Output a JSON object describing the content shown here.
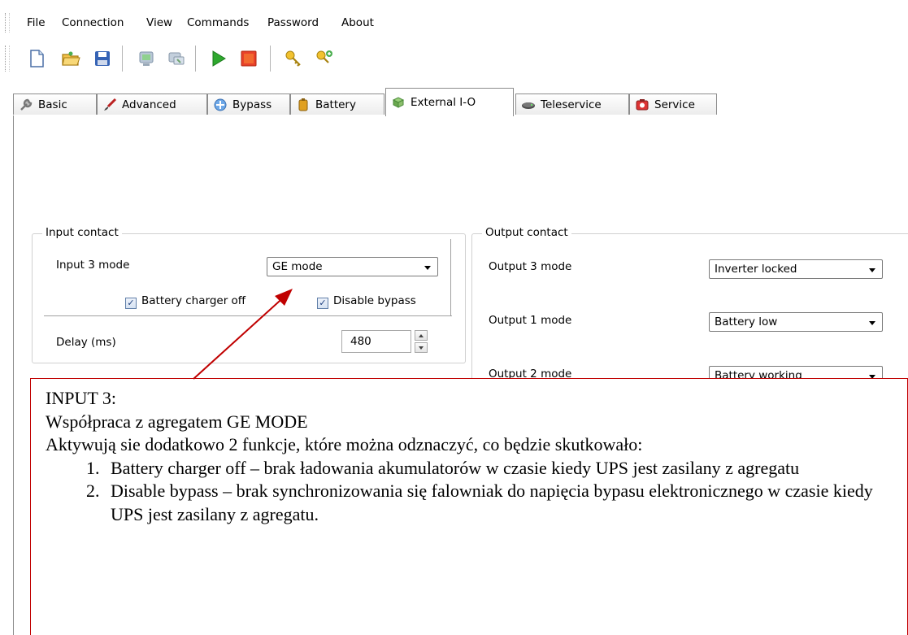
{
  "menu": [
    "File",
    "Connection",
    "View",
    "Commands",
    "Password",
    "About"
  ],
  "toolbar_icons": [
    "new-document-icon",
    "open-folder-icon",
    "save-icon",
    "connect-icon",
    "disconnect-icon",
    "start-icon",
    "stop-icon",
    "key-icon",
    "key-add-icon"
  ],
  "tabs": [
    {
      "label": "Basic",
      "icon": "wrench-icon",
      "active": false
    },
    {
      "label": "Advanced",
      "icon": "brush-icon",
      "active": false
    },
    {
      "label": "Bypass",
      "icon": "bypass-icon",
      "active": false
    },
    {
      "label": "Battery",
      "icon": "battery-icon",
      "active": false
    },
    {
      "label": "External I-O",
      "icon": "external-io-icon",
      "active": true
    },
    {
      "label": "Teleservice",
      "icon": "modem-icon",
      "active": false
    },
    {
      "label": "Service",
      "icon": "service-icon",
      "active": false
    }
  ],
  "input_contact": {
    "title": "Input contact",
    "mode_label": "Input 3 mode",
    "mode_value": "GE mode",
    "battery_charger_off": {
      "label": "Battery charger off",
      "checked": true
    },
    "disable_bypass": {
      "label": "Disable bypass",
      "checked": true
    },
    "delay_label": "Delay (ms)",
    "delay_value": "480"
  },
  "output_contact": {
    "title": "Output contact",
    "rows": [
      {
        "label": "Output 3 mode",
        "value": "Inverter locked"
      },
      {
        "label": "Output 1 mode",
        "value": "Battery low"
      },
      {
        "label": "Output 2 mode",
        "value": "Battery working"
      }
    ]
  },
  "annotation": {
    "heading": "INPUT 3:",
    "line1": "Współpraca z agregatem GE MODE",
    "line2": "Aktywują sie dodatkowo 2 funkcje, które można odznaczyć, co będzie skutkowało:",
    "items": [
      "Battery charger off – brak ładowania akumulatorów w czasie kiedy UPS jest zasilany z agregatu",
      "Disable bypass – brak synchronizowania się falowniak do napięcia bypasu elektronicznego w czasie kiedy UPS jest zasilany z agregatu."
    ],
    "color": "#c00000"
  }
}
